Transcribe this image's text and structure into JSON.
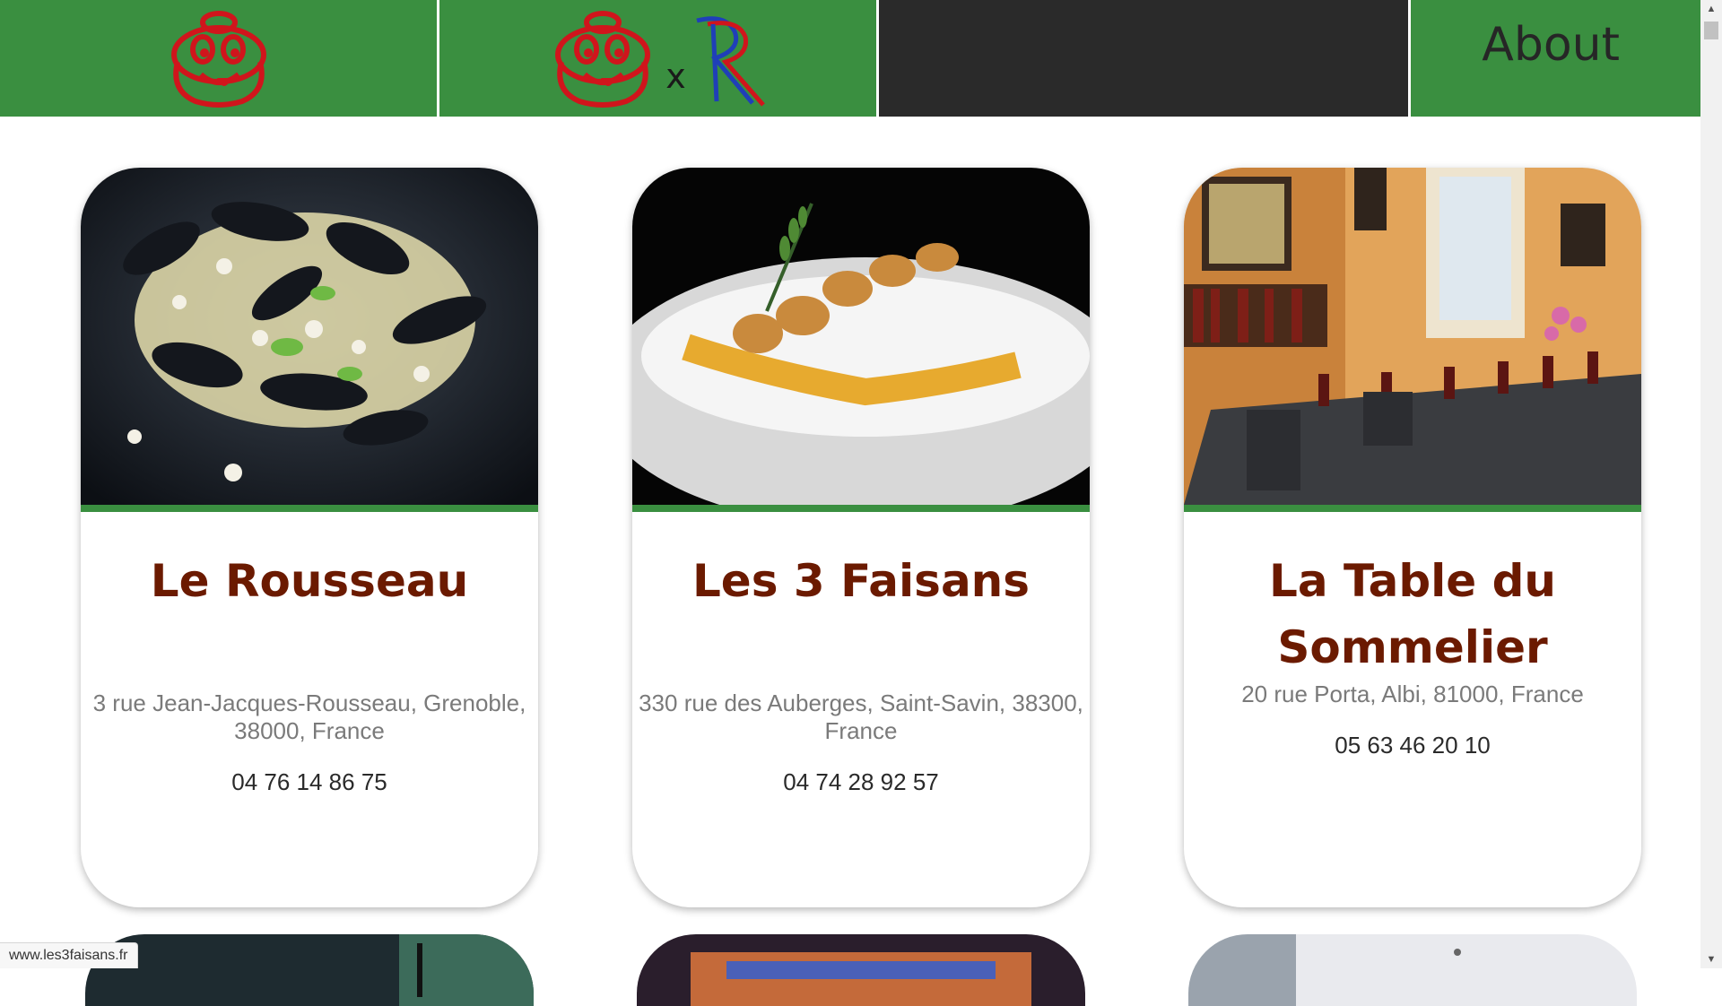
{
  "header": {
    "nav": [
      {
        "kind": "michelin-logo"
      },
      {
        "kind": "collab-logo",
        "separator": "x"
      },
      {
        "kind": "empty"
      },
      {
        "kind": "link",
        "label": "About"
      }
    ]
  },
  "colors": {
    "header_green": "#3a8f40",
    "header_dark": "#2a2a2a",
    "restaurant_name": "#6b1a00",
    "address_gray": "#7a7a7a",
    "michelin_red": "#d0151c"
  },
  "restaurants": [
    {
      "name": "Le Rousseau",
      "address": "3 rue Jean-Jacques-Rousseau, Grenoble, 38000, France",
      "phone": "04 76 14 86 75",
      "photo": "mussels-dish-photo"
    },
    {
      "name": "Les 3 Faisans",
      "address": "330 rue des Auberges, Saint-Savin, 38300, France",
      "phone": "04 74 28 92 57",
      "photo": "plated-fish-photo"
    },
    {
      "name": "La Table du Sommelier",
      "address": "20 rue Porta, Albi, 81000, France",
      "phone": "05 63 46 20 10",
      "photo": "dining-room-photo"
    }
  ],
  "status_bar": {
    "url": "www.les3faisans.fr"
  }
}
